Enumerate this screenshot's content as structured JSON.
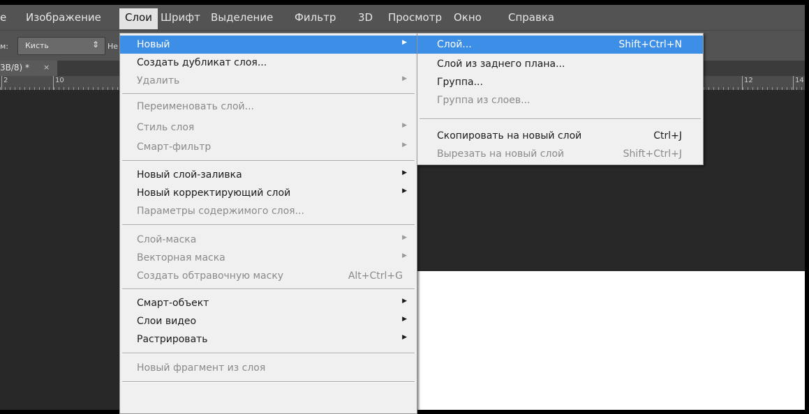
{
  "menubar": {
    "items": [
      "е",
      "Изображение",
      "Слои",
      "Шрифт",
      "Выделение",
      "Фильтр",
      "3D",
      "Просмотр",
      "Окно",
      "Справка"
    ]
  },
  "options": {
    "mode_label": "м:",
    "brush_value": "Кисть",
    "more_label": "Не"
  },
  "tab": {
    "title": "3B/8) *",
    "close": "×"
  },
  "ruler": {
    "labels": [
      "2",
      "10",
      "12",
      "14"
    ]
  },
  "layer_menu": {
    "items": [
      {
        "label": "Новый",
        "submenu": true,
        "enabled": true,
        "highlighted": true
      },
      {
        "label": "Создать дубликат слоя...",
        "enabled": true
      },
      {
        "label": "Удалить",
        "submenu": true,
        "enabled": false
      },
      {
        "separator": true
      },
      {
        "label": "Переименовать слой...",
        "enabled": false
      },
      {
        "label": "Стиль слоя",
        "submenu": true,
        "enabled": false
      },
      {
        "label": "Смарт-фильтр",
        "submenu": true,
        "enabled": false
      },
      {
        "separator": true
      },
      {
        "label": "Новый слой-заливка",
        "submenu": true,
        "enabled": true
      },
      {
        "label": "Новый корректирующий слой",
        "submenu": true,
        "enabled": true
      },
      {
        "label": "Параметры содержимого слоя...",
        "enabled": false
      },
      {
        "separator": true
      },
      {
        "label": "Слой-маска",
        "submenu": true,
        "enabled": false
      },
      {
        "label": "Векторная маска",
        "submenu": true,
        "enabled": false
      },
      {
        "label": "Создать обтравочную маску",
        "shortcut": "Alt+Ctrl+G",
        "enabled": false
      },
      {
        "separator": true
      },
      {
        "label": "Смарт-объект",
        "submenu": true,
        "enabled": true
      },
      {
        "label": "Слои видео",
        "submenu": true,
        "enabled": true
      },
      {
        "label": "Растрировать",
        "submenu": true,
        "enabled": true
      },
      {
        "separator": true
      },
      {
        "label": "Новый фрагмент из слоя",
        "enabled": false
      },
      {
        "separator": true
      }
    ]
  },
  "new_submenu": {
    "items": [
      {
        "label": "Слой...",
        "shortcut": "Shift+Ctrl+N",
        "enabled": true,
        "highlighted": true
      },
      {
        "label": "Слой из заднего плана...",
        "enabled": true
      },
      {
        "label": "Группа...",
        "enabled": true
      },
      {
        "label": "Группа из слоев...",
        "enabled": false
      },
      {
        "separator": true
      },
      {
        "label": "Скопировать на новый слой",
        "shortcut": "Ctrl+J",
        "enabled": true
      },
      {
        "label": "Вырезать на новый слой",
        "shortcut": "Shift+Ctrl+J",
        "enabled": false
      }
    ]
  },
  "colors": {
    "highlight": "#3d8ee6",
    "menu_bg": "#f0f0f0",
    "app_bg": "#282828",
    "bar_bg": "#535353"
  }
}
